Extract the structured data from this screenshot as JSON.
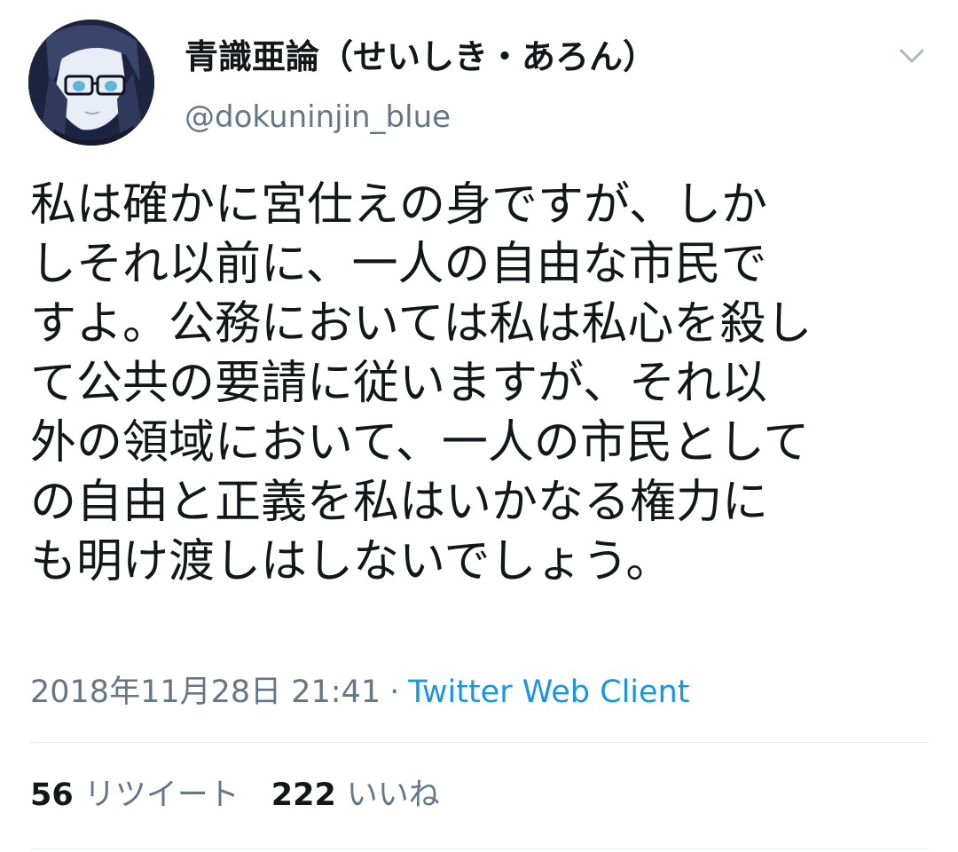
{
  "tweet": {
    "display_name": "青識亜論（せいしき・あろん）",
    "handle": "@dokuninjin_blue",
    "text_lines": [
      "私は確かに宮仕えの身ですが、しか",
      "しそれ以前に、一人の自由な市民で",
      "すよ。公務においては私は私心を殺し",
      "て公共の要請に従いますが、それ以",
      "外の領域において、一人の市民として",
      "の自由と正義を私はいかなる権力に",
      "も明け渡しはしないでしょう。"
    ],
    "timestamp": "2018年11月28日 21:41",
    "separator": "·",
    "client": "Twitter Web Client",
    "retweet_count": "56",
    "retweet_label": "リツイート",
    "like_count": "222",
    "like_label": "いいね"
  },
  "icons": {
    "menu": "chevron-down-icon",
    "avatar": "avatar-illustration"
  },
  "colors": {
    "text": "#14171a",
    "secondary": "#657786",
    "link": "#1b95e0",
    "divider": "#e6ecf0"
  }
}
